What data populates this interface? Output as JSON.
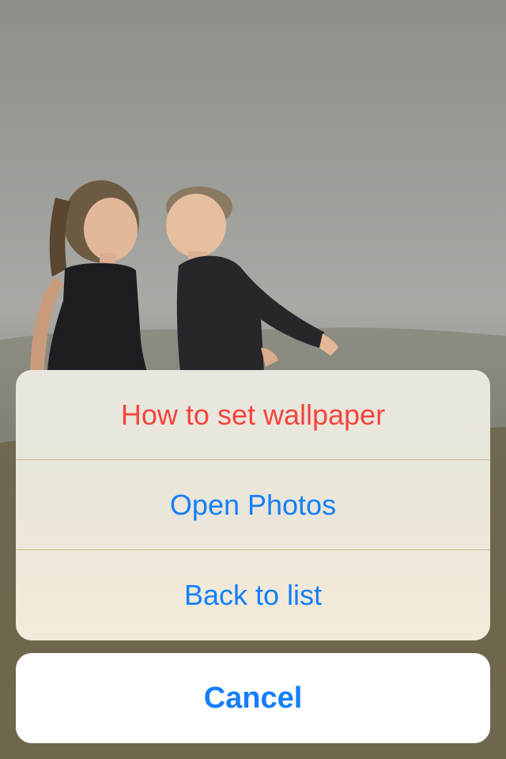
{
  "action_sheet": {
    "items": [
      {
        "label": "How to set wallpaper",
        "style": "destructive"
      },
      {
        "label": "Open Photos",
        "style": "default"
      },
      {
        "label": "Back to list",
        "style": "default"
      }
    ],
    "cancel_label": "Cancel"
  },
  "colors": {
    "accent": "#147efb",
    "destructive": "#f2453d"
  }
}
